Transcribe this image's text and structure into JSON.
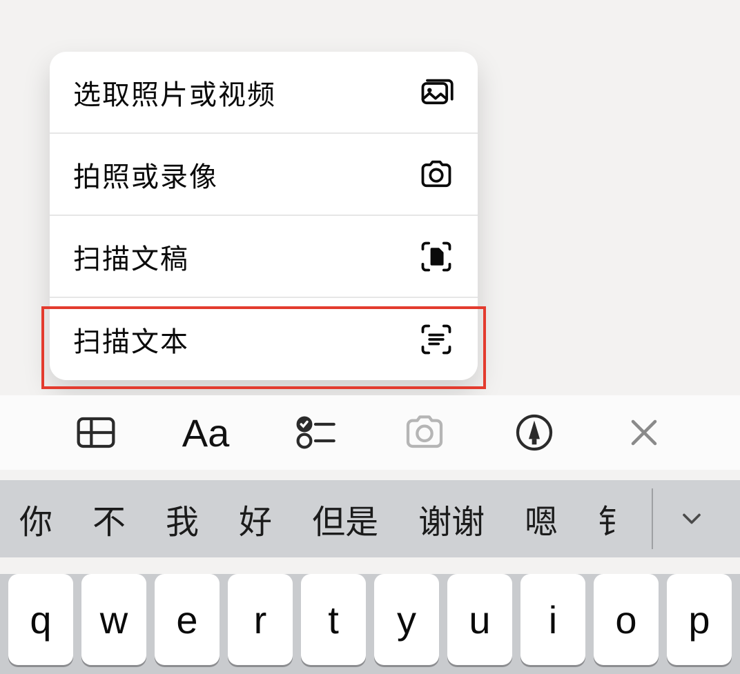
{
  "menu": {
    "items": [
      {
        "label": "选取照片或视频",
        "icon": "photo-stack-icon"
      },
      {
        "label": "拍照或录像",
        "icon": "camera-icon"
      },
      {
        "label": "扫描文稿",
        "icon": "doc-scan-icon"
      },
      {
        "label": "扫描文本",
        "icon": "text-scan-icon"
      }
    ],
    "highlight_index": 3
  },
  "toolbar": {
    "items": [
      {
        "name": "table-icon"
      },
      {
        "name": "text-format-icon",
        "label": "Aa"
      },
      {
        "name": "checklist-icon"
      },
      {
        "name": "camera-icon",
        "dim": true
      },
      {
        "name": "markup-icon"
      },
      {
        "name": "close-icon"
      }
    ]
  },
  "candidates": [
    "你",
    "不",
    "我",
    "好",
    "但是",
    "谢谢",
    "嗯",
    "钅"
  ],
  "keyboard_row": [
    "q",
    "w",
    "e",
    "r",
    "t",
    "y",
    "u",
    "i",
    "o",
    "p"
  ],
  "colors": {
    "highlight": "#e33b2e"
  }
}
